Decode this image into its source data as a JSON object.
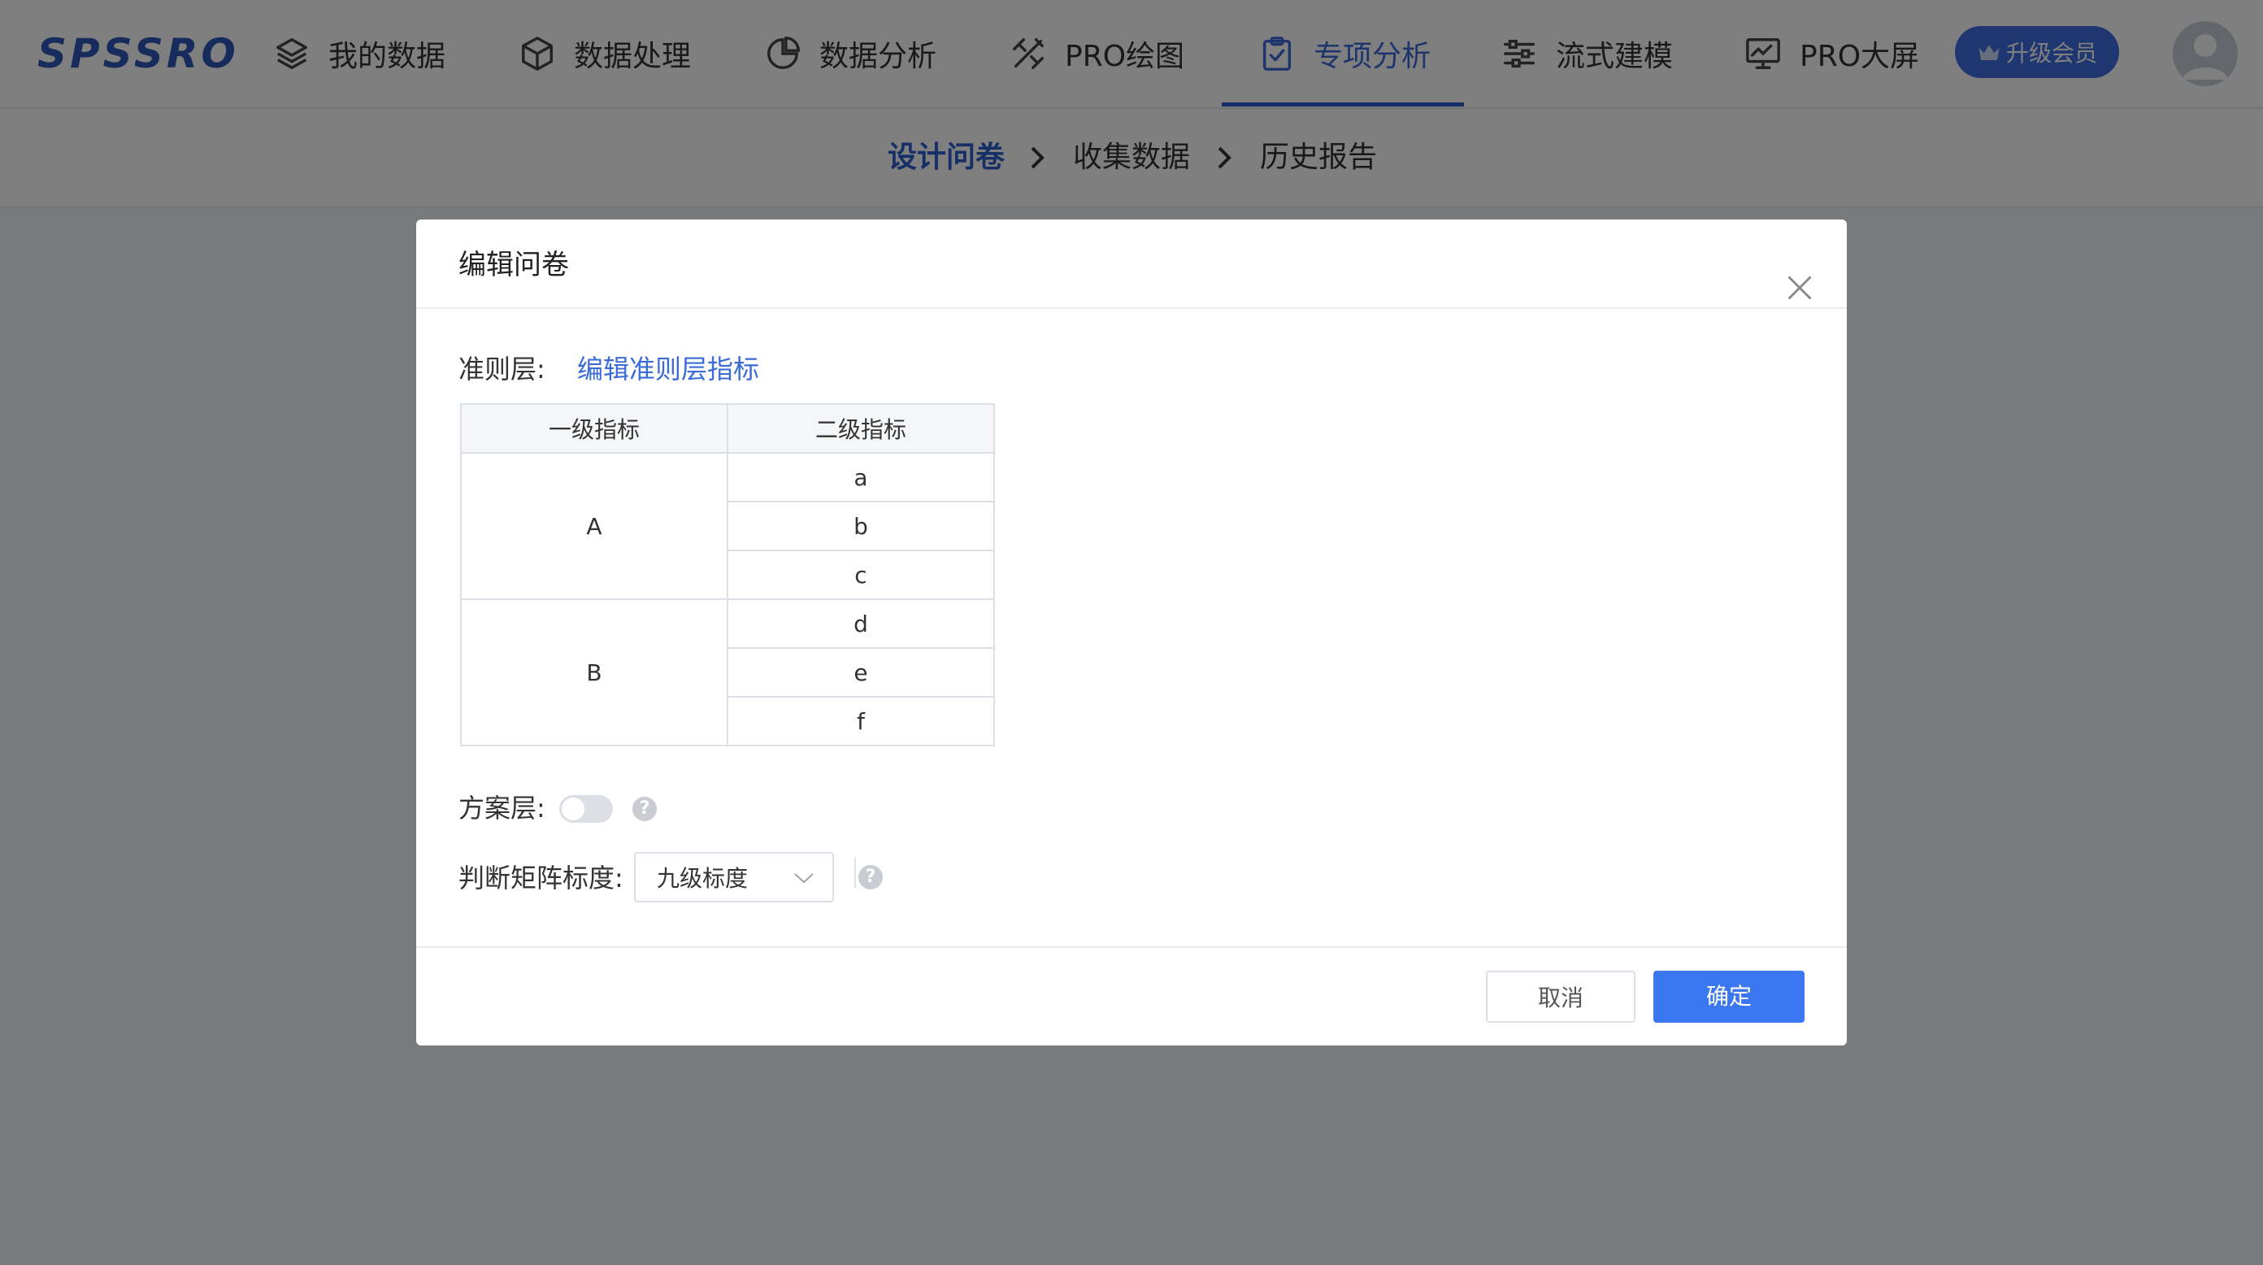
{
  "app": {
    "logo": "SPSSRO",
    "nav": [
      {
        "label": "我的数据",
        "icon": "layers-icon"
      },
      {
        "label": "数据处理",
        "icon": "cube-icon"
      },
      {
        "label": "数据分析",
        "icon": "pie-chart-icon"
      },
      {
        "label": "PRO绘图",
        "icon": "drawing-tools-icon"
      },
      {
        "label": "专项分析",
        "icon": "clipboard-check-icon",
        "active": true
      },
      {
        "label": "流式建模",
        "icon": "sliders-icon"
      },
      {
        "label": "PRO大屏",
        "icon": "monitor-chart-icon"
      }
    ],
    "vip_label": "升级会员",
    "colors": {
      "accent": "#2d5fcf",
      "primary_button": "#3a77f0",
      "vip": "#3d6fe0"
    }
  },
  "steps": [
    {
      "label": "设计问卷",
      "active": true
    },
    {
      "label": "收集数据"
    },
    {
      "label": "历史报告"
    }
  ],
  "dialog": {
    "title": "编辑问卷",
    "criteria_label": "准则层:",
    "criteria_link": "编辑准则层指标",
    "table": {
      "headers": [
        "一级指标",
        "二级指标"
      ],
      "groups": [
        {
          "primary": "A",
          "secondary": [
            "a",
            "b",
            "c"
          ]
        },
        {
          "primary": "B",
          "secondary": [
            "d",
            "e",
            "f"
          ]
        }
      ]
    },
    "scheme_label": "方案层:",
    "scheme_enabled": false,
    "scale_label": "判断矩阵标度:",
    "scale_value": "九级标度",
    "help_glyph": "?",
    "cancel_label": "取消",
    "ok_label": "确定"
  }
}
